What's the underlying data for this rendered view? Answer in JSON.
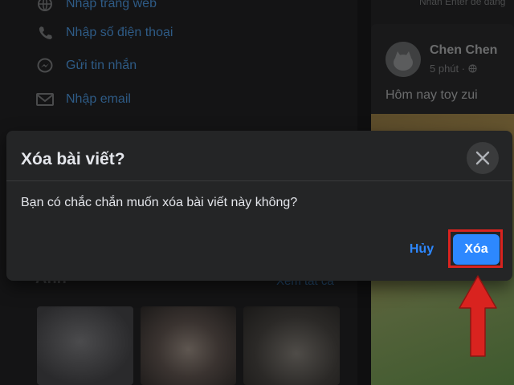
{
  "contact_items": [
    {
      "label": "Nhập trang web",
      "icon": "globe-icon"
    },
    {
      "label": "Nhập số điện thoại",
      "icon": "phone-icon"
    },
    {
      "label": "Gửi tin nhắn",
      "icon": "messenger-icon"
    },
    {
      "label": "Nhập email",
      "icon": "mail-icon"
    }
  ],
  "photos": {
    "title": "Ảnh",
    "see_all": "Xem tất cả"
  },
  "feed": {
    "hint": "Nhấn Enter để đăng",
    "post": {
      "author": "Chen Chen",
      "time": "5 phút · ",
      "text": "Hôm nay toy zui"
    }
  },
  "dialog": {
    "title": "Xóa bài viết?",
    "message": "Bạn có chắc chắn muốn xóa bài viết này không?",
    "cancel_label": "Hủy",
    "confirm_label": "Xóa"
  },
  "annotation": {
    "highlight_color": "#d9231f"
  },
  "colors": {
    "accent": "#2d88ff",
    "modal_bg": "#242526",
    "text": "#e4e6eb"
  }
}
